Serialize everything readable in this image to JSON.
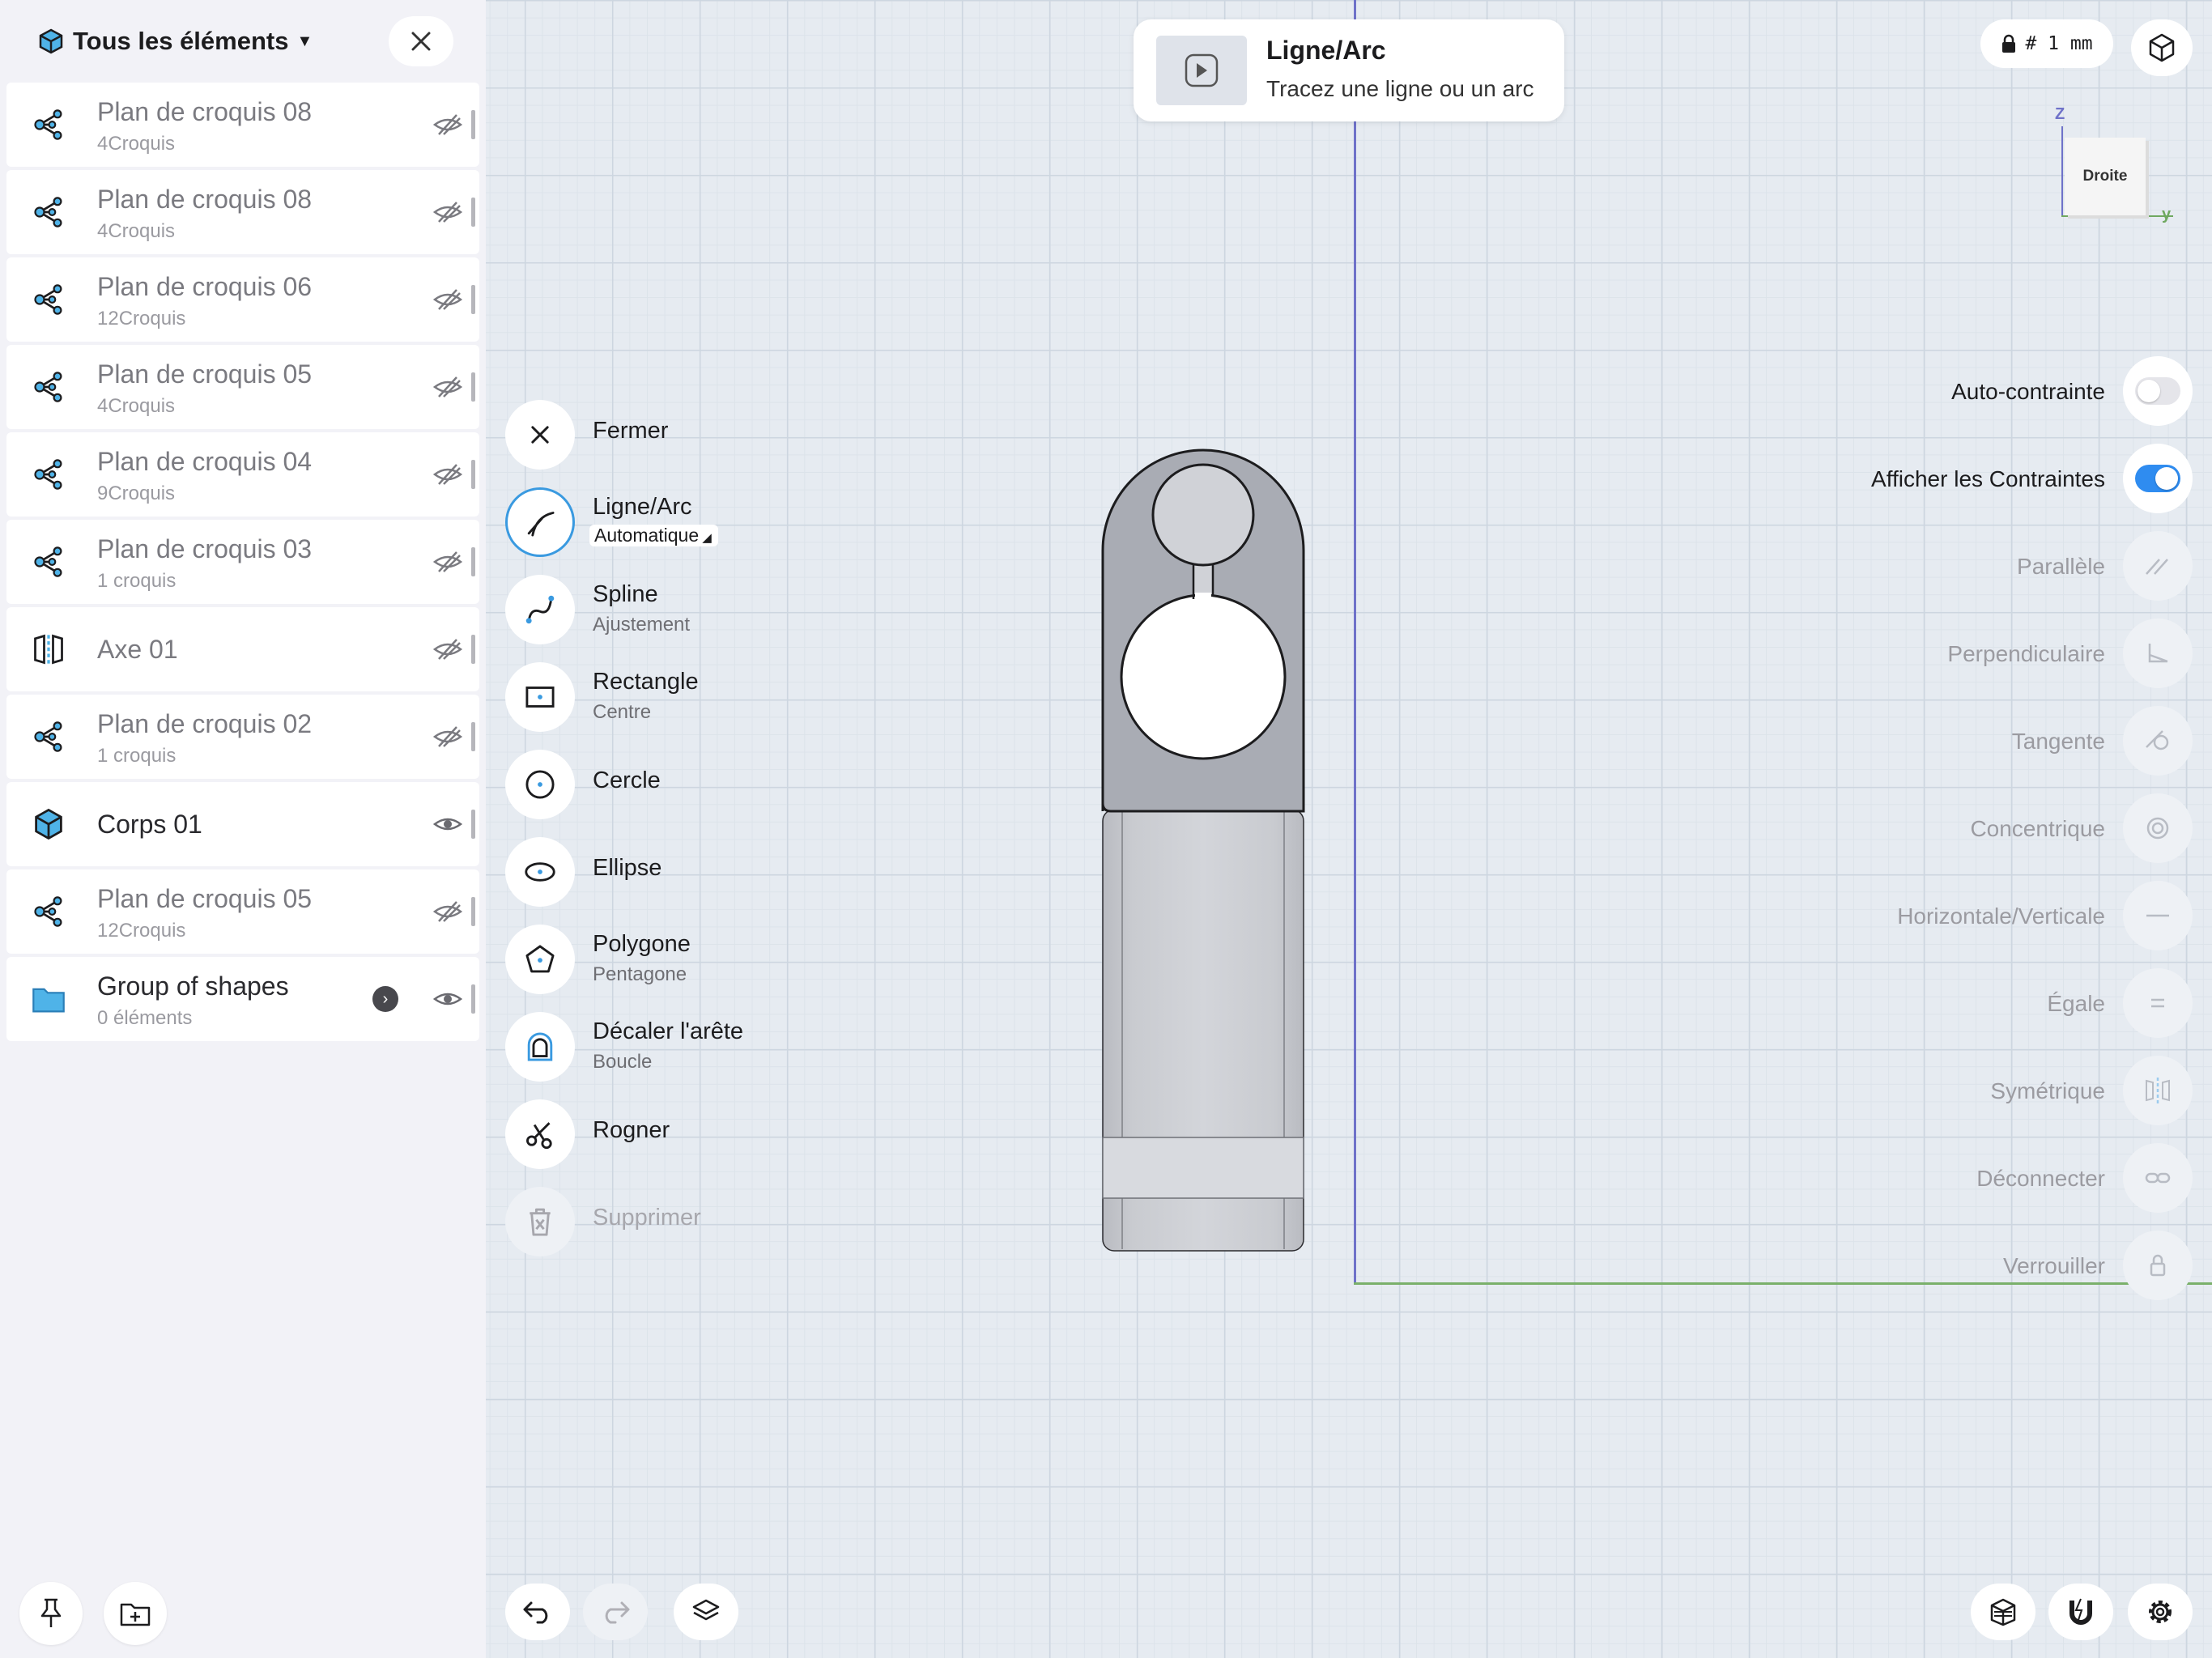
{
  "sidebar": {
    "title": "Tous les éléments",
    "items": [
      {
        "name": "Plan de croquis 08",
        "sub": "4Croquis",
        "icon": "sketch-plane-icon",
        "visible": false
      },
      {
        "name": "Plan de croquis 08",
        "sub": "4Croquis",
        "icon": "sketch-plane-icon",
        "visible": false
      },
      {
        "name": "Plan de croquis 06",
        "sub": "12Croquis",
        "icon": "sketch-plane-icon",
        "visible": false
      },
      {
        "name": "Plan de croquis 05",
        "sub": "4Croquis",
        "icon": "sketch-plane-icon",
        "visible": false
      },
      {
        "name": "Plan de croquis 04",
        "sub": "9Croquis",
        "icon": "sketch-plane-icon",
        "visible": false
      },
      {
        "name": "Plan de croquis 03",
        "sub": "1 croquis",
        "icon": "sketch-plane-icon",
        "visible": false
      },
      {
        "name": "Axe 01",
        "sub": "",
        "icon": "axis-icon",
        "visible": false
      },
      {
        "name": "Plan de croquis 02",
        "sub": "1 croquis",
        "icon": "sketch-plane-icon",
        "visible": false
      },
      {
        "name": "Corps 01",
        "sub": "",
        "icon": "body-cube-icon",
        "visible": true
      },
      {
        "name": "Plan de croquis 05",
        "sub": "12Croquis",
        "icon": "sketch-plane-icon",
        "visible": false
      },
      {
        "name": "Group of shapes",
        "sub": "0 éléments",
        "icon": "folder-icon",
        "visible": true
      }
    ]
  },
  "notification": {
    "title": "Ligne/Arc",
    "description": "Tracez une ligne ou un arc"
  },
  "tools": [
    {
      "label": "Fermer",
      "sub": "",
      "icon": "close-icon"
    },
    {
      "label": "Ligne/Arc",
      "sub": "Automatique",
      "icon": "line-arc-icon"
    },
    {
      "label": "Spline",
      "sub": "Ajustement",
      "icon": "spline-icon"
    },
    {
      "label": "Rectangle",
      "sub": "Centre",
      "icon": "rectangle-icon"
    },
    {
      "label": "Cercle",
      "sub": "",
      "icon": "circle-icon"
    },
    {
      "label": "Ellipse",
      "sub": "",
      "icon": "ellipse-icon"
    },
    {
      "label": "Polygone",
      "sub": "Pentagone",
      "icon": "polygon-icon"
    },
    {
      "label": "Décaler l'arête",
      "sub": "Boucle",
      "icon": "offset-edge-icon"
    },
    {
      "label": "Rogner",
      "sub": "",
      "icon": "trim-scissors-icon"
    },
    {
      "label": "Supprimer",
      "sub": "",
      "icon": "trash-icon"
    }
  ],
  "topright": {
    "unit": "# 1 mm",
    "view_face": "Droite",
    "axis_z": "Z",
    "axis_y": "y"
  },
  "constraints": [
    {
      "label": "Auto-contrainte",
      "type": "toggle",
      "on": false
    },
    {
      "label": "Afficher les Contraintes",
      "type": "toggle",
      "on": true
    },
    {
      "label": "Parallèle",
      "icon": "parallel-icon"
    },
    {
      "label": "Perpendiculaire",
      "icon": "perpendicular-icon"
    },
    {
      "label": "Tangente",
      "icon": "tangent-icon"
    },
    {
      "label": "Concentrique",
      "icon": "concentric-icon"
    },
    {
      "label": "Horizontale/Verticale",
      "icon": "horizontal-vertical-icon"
    },
    {
      "label": "Égale",
      "icon": "equal-icon"
    },
    {
      "label": "Symétrique",
      "icon": "symmetric-icon"
    },
    {
      "label": "Déconnecter",
      "icon": "disconnect-icon"
    },
    {
      "label": "Verrouiller",
      "icon": "lock-icon"
    }
  ],
  "colors": {
    "accent": "#2f8cf0",
    "canvas": "#e6ebf1",
    "part": "#a9acb4",
    "z_axis": "#6f72c9",
    "y_axis": "#7ab06b"
  }
}
